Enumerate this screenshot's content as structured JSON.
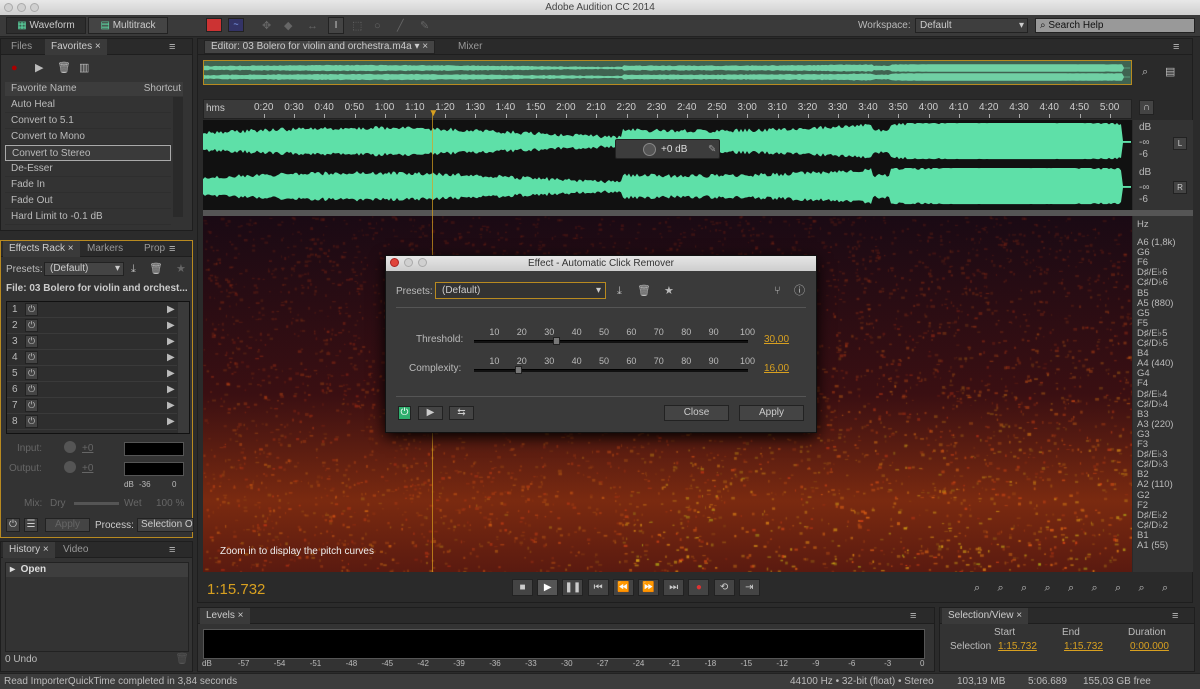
{
  "app": {
    "title": "Adobe Audition CC 2014"
  },
  "toolbar": {
    "waveform": "Waveform",
    "multitrack": "Multitrack",
    "workspace_label": "Workspace:",
    "workspace_value": "Default",
    "search_placeholder": "Search Help"
  },
  "files_panel": {
    "tabs": [
      "Files",
      "Favorites"
    ],
    "col_name": "Favorite Name",
    "col_shortcut": "Shortcut",
    "items": [
      "Auto Heal",
      "Convert to 5.1",
      "Convert to Mono",
      "Convert to Stereo",
      "De-Esser",
      "Fade In",
      "Fade Out",
      "Hard Limit to -0.1 dB"
    ],
    "selected": "Convert to Stereo"
  },
  "effects_rack": {
    "tabs": [
      "Effects Rack",
      "Markers",
      "Prop"
    ],
    "presets_label": "Presets:",
    "preset": "(Default)",
    "file": "File: 03 Bolero for violin and orchest...",
    "slots": [
      "1",
      "2",
      "3",
      "4",
      "5",
      "6",
      "7",
      "8"
    ],
    "input_label": "Input:",
    "input_value": "+0",
    "output_label": "Output:",
    "output_value": "+0",
    "meter_scale": [
      "dB",
      "-36",
      "0"
    ],
    "mix_label": "Mix:",
    "dry": "Dry",
    "wet": "Wet",
    "mix_value": "100 %",
    "apply": "Apply",
    "process_label": "Process:",
    "process_value": "Selection Only"
  },
  "history": {
    "tabs": [
      "History",
      "Video"
    ],
    "items": [
      "Open"
    ],
    "undo": "0 Undo"
  },
  "editor": {
    "tab": "Editor: 03 Bolero for violin and orchestra.m4a",
    "mixer_tab": "Mixer",
    "time_unit": "hms",
    "ticks": [
      "0:20",
      "0:30",
      "0:40",
      "0:50",
      "1:00",
      "1:10",
      "1:20",
      "1:30",
      "1:40",
      "1:50",
      "2:00",
      "2:10",
      "2:20",
      "2:30",
      "2:40",
      "2:50",
      "3:00",
      "3:10",
      "3:20",
      "3:30",
      "3:40",
      "3:50",
      "4:00",
      "4:10",
      "4:20",
      "4:30",
      "4:40",
      "4:50",
      "5:00"
    ],
    "hud_gain": "+0 dB",
    "channel_l": "L",
    "channel_r": "R",
    "db_labels": [
      "dB",
      "-∞",
      "-6"
    ],
    "hz_unit": "Hz",
    "hz_labels": [
      "A6 (1,8k)",
      "G6",
      "F6",
      "D♯/E♭6",
      "C♯/D♭6",
      "B5",
      "A5 (880)",
      "G5",
      "F5",
      "D♯/E♭5",
      "C♯/D♭5",
      "B4",
      "A4 (440)",
      "G4",
      "F4",
      "D♯/E♭4",
      "C♯/D♭4",
      "B3",
      "A3 (220)",
      "G3",
      "F3",
      "D♯/E♭3",
      "C♯/D♭3",
      "B2",
      "A2 (110)",
      "G2",
      "F2",
      "D♯/E♭2",
      "C♯/D♭2",
      "B1",
      "A1 (55)"
    ],
    "pitch_hint": "Zoom in to display the pitch curves",
    "current_time": "1:15.732",
    "playhead_seconds": 75.732,
    "waveform_color": "#5ee0a8"
  },
  "dialog": {
    "title": "Effect - Automatic Click Remover",
    "presets_label": "Presets:",
    "preset": "(Default)",
    "scale": [
      "10",
      "20",
      "30",
      "40",
      "50",
      "60",
      "70",
      "80",
      "90",
      "100"
    ],
    "threshold": {
      "label": "Threshold:",
      "value": "30,00",
      "level": 30
    },
    "complexity": {
      "label": "Complexity:",
      "value": "16,00",
      "level": 16
    },
    "close": "Close",
    "apply": "Apply"
  },
  "levels": {
    "title": "Levels",
    "scale": [
      "dB",
      "-57",
      "-54",
      "-51",
      "-48",
      "-45",
      "-42",
      "-39",
      "-36",
      "-33",
      "-30",
      "-27",
      "-24",
      "-21",
      "-18",
      "-15",
      "-12",
      "-9",
      "-6",
      "-3",
      "0"
    ]
  },
  "selection_view": {
    "title": "Selection/View",
    "start": "Start",
    "end": "End",
    "duration": "Duration",
    "row": "Selection",
    "start_value": "1:15.732",
    "end_value": "1:15.732",
    "duration_value": "0:00.000"
  },
  "status": {
    "message": "Read ImporterQuickTime completed in 3,84 seconds",
    "format": "44100 Hz • 32-bit (float) • Stereo",
    "size": "103,19 MB",
    "duration": "5:06.689",
    "free": "155,03 GB free"
  },
  "colors": {
    "accent": "#d8a020",
    "waveform": "#5ee0a8",
    "power_on": "#2fae6e"
  }
}
